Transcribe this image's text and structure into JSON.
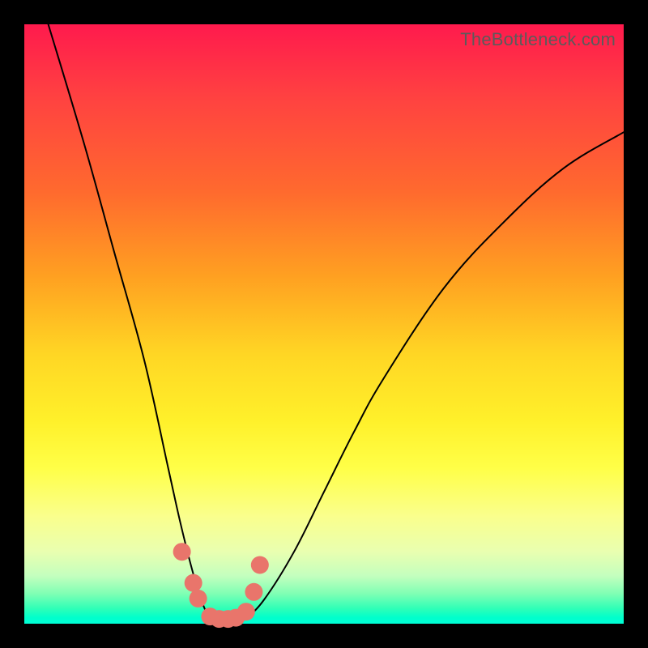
{
  "watermark": "TheBottleneck.com",
  "chart_data": {
    "type": "line",
    "title": "",
    "xlabel": "",
    "ylabel": "",
    "xlim": [
      0,
      100
    ],
    "ylim": [
      0,
      100
    ],
    "grid": false,
    "legend": false,
    "series": [
      {
        "name": "bottleneck-curve",
        "x": [
          4,
          10,
          15,
          20,
          24,
          26,
          28,
          29.5,
          31,
          33,
          35,
          37,
          40,
          45,
          50,
          55,
          60,
          70,
          80,
          90,
          100
        ],
        "values": [
          100,
          80,
          62,
          44,
          26,
          17,
          9,
          4,
          1,
          0,
          0,
          1,
          4,
          12,
          22,
          32,
          41,
          56,
          67,
          76,
          82
        ]
      }
    ],
    "markers": {
      "name": "highlight-dots",
      "x": [
        26.3,
        28.2,
        29.0,
        31.0,
        32.5,
        34.0,
        35.3,
        37.0,
        38.3,
        39.3
      ],
      "values": [
        12.0,
        6.8,
        4.2,
        1.2,
        0.8,
        0.8,
        1.0,
        2.0,
        5.3,
        9.8
      ]
    }
  },
  "colors": {
    "curve": "#000000",
    "marker": "#e9756b"
  }
}
